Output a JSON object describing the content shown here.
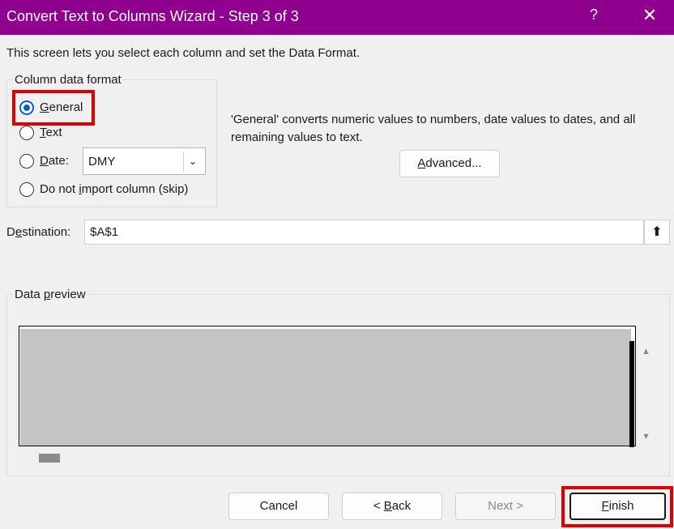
{
  "window": {
    "title": "Convert Text to Columns Wizard - Step 3 of 3",
    "help_label": "?",
    "close_label": "✕"
  },
  "intro": "This screen lets you select each column and set the Data Format.",
  "column_format": {
    "legend": "Column data format",
    "options": {
      "general": {
        "before": "",
        "accel": "G",
        "after": "eneral",
        "checked": true
      },
      "text": {
        "before": "",
        "accel": "T",
        "after": "ext",
        "checked": false
      },
      "date": {
        "before": "",
        "accel": "D",
        "after": "ate:",
        "checked": false
      },
      "skip": {
        "before": "Do not ",
        "accel": "i",
        "after": "mport column (skip)",
        "checked": false
      }
    },
    "date_select": {
      "value": "DMY"
    }
  },
  "description": {
    "line1": "'General' converts numeric values to numbers, date values to dates, and all",
    "line2": "remaining values to text."
  },
  "advanced": {
    "accel": "A",
    "rest": "dvanced..."
  },
  "destination": {
    "label_before": "D",
    "label_accel": "e",
    "label_after": "stination:",
    "value": "$A$1"
  },
  "data_preview": {
    "legend_before": "Data ",
    "legend_accel": "p",
    "legend_after": "review"
  },
  "buttons": {
    "cancel": "Cancel",
    "back": {
      "before": "< ",
      "accel": "B",
      "after": "ack"
    },
    "next": "Next >",
    "finish": {
      "accel": "F",
      "after": "inish"
    }
  },
  "colors": {
    "titlebar": "#8f008f",
    "highlight": "#e00000",
    "radio_selected": "#0a5fbf"
  }
}
